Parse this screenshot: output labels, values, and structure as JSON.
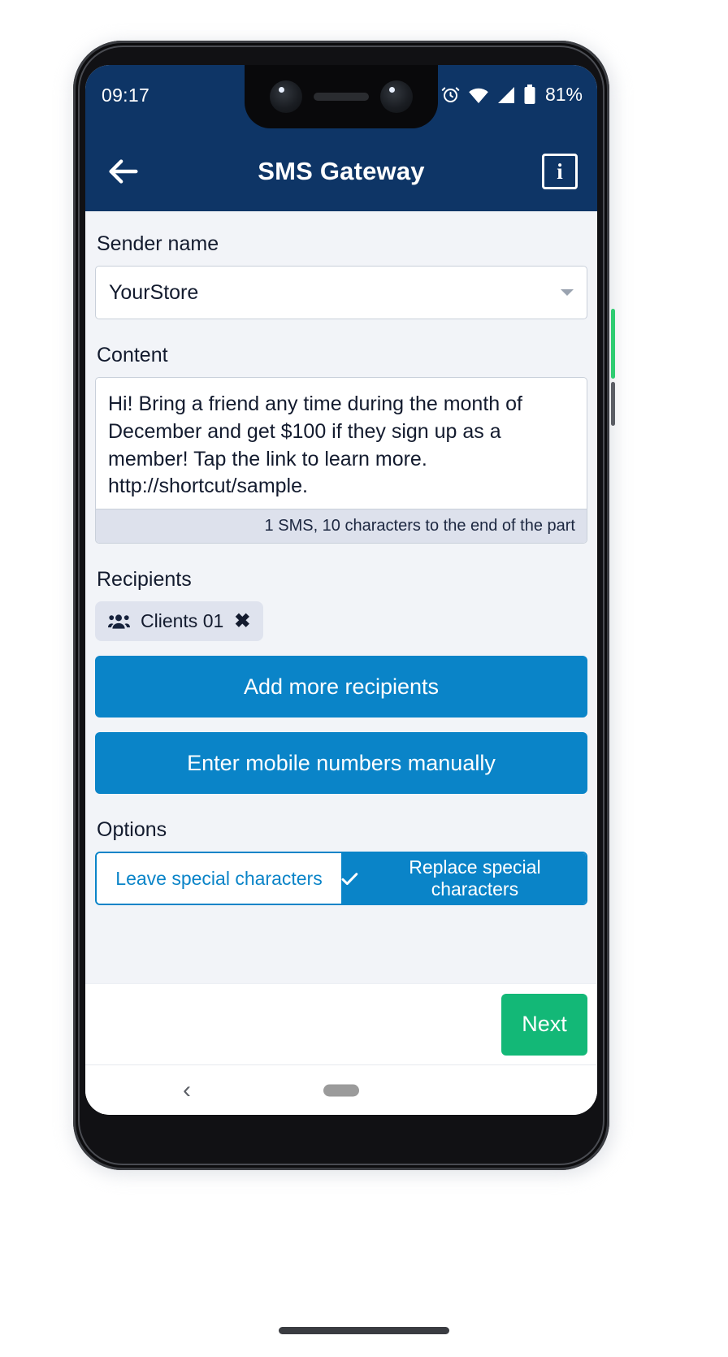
{
  "status_bar": {
    "time": "09:17",
    "battery_percent": "81%",
    "icons": [
      "alarm-icon",
      "wifi-icon",
      "signal-icon",
      "battery-icon"
    ]
  },
  "app_bar": {
    "title": "SMS Gateway",
    "back_icon": "arrow-left-icon",
    "info_icon": "info-icon",
    "background_color": "#0e3566"
  },
  "form": {
    "sender": {
      "label": "Sender name",
      "value": "YourStore",
      "caret_icon": "chevron-down-icon"
    },
    "content": {
      "label": "Content",
      "value": "Hi! Bring a friend any time during the month of December and get $100 if they sign up as a member! Tap the link to learn more. http://shortcut/sample.",
      "counter": "1 SMS, 10 characters to the end of the part"
    },
    "recipients": {
      "label": "Recipients",
      "chips": [
        {
          "icon": "people-group-icon",
          "label": "Clients 01",
          "close_icon": "close-icon"
        }
      ],
      "add_more_label": "Add more recipients",
      "manual_label": "Enter mobile numbers manually"
    },
    "options": {
      "label": "Options",
      "choices": [
        {
          "label": "Leave special characters",
          "selected": false
        },
        {
          "label": "Replace special characters",
          "selected": true,
          "check_icon": "check-icon"
        }
      ]
    }
  },
  "footer": {
    "next_label": "Next",
    "next_color": "#13b877"
  },
  "navigation_bar": {
    "back_icon": "chevron-left-icon",
    "home_pill": "home-pill-indicator"
  },
  "theme": {
    "primary": "#0a84c8",
    "header": "#0e3566",
    "page_bg": "#f2f4f8",
    "success": "#13b877"
  }
}
